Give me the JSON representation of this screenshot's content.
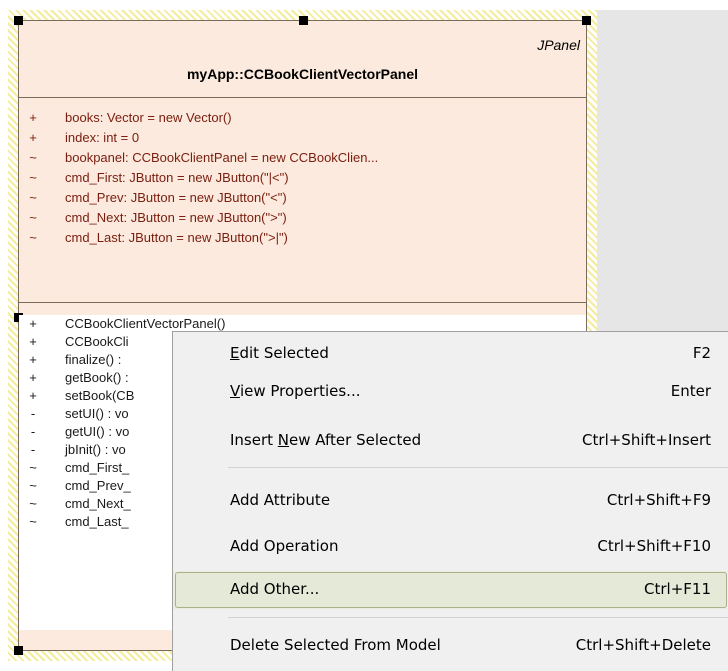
{
  "uml_class": {
    "stereotype": "JPanel",
    "name": "myApp::CCBookClientVectorPanel",
    "attributes": [
      {
        "vis": "+",
        "text": "books:  Vector = new Vector()"
      },
      {
        "vis": "+",
        "text": "index:  int = 0"
      },
      {
        "vis": "~",
        "text": "bookpanel:  CCBookClientPanel = new CCBookClien..."
      },
      {
        "vis": "~",
        "text": "cmd_First:  JButton = new JButton(\"|<\")"
      },
      {
        "vis": "~",
        "text": "cmd_Prev:  JButton = new JButton(\"<\")"
      },
      {
        "vis": "~",
        "text": "cmd_Next:  JButton = new JButton(\">\")"
      },
      {
        "vis": "~",
        "text": "cmd_Last:  JButton = new JButton(\">|\")"
      }
    ],
    "operations": [
      {
        "vis": "+",
        "text": "CCBookClientVectorPanel()"
      },
      {
        "vis": "+",
        "text": "CCBookCli"
      },
      {
        "vis": "+",
        "text": "finalize() :"
      },
      {
        "vis": "+",
        "text": "getBook() :"
      },
      {
        "vis": "+",
        "text": "setBook(CB"
      },
      {
        "vis": "-",
        "text": "setUI() : vo"
      },
      {
        "vis": "-",
        "text": "getUI() : vo"
      },
      {
        "vis": "-",
        "text": "jbInit() : vo"
      },
      {
        "vis": "~",
        "text": "cmd_First_"
      },
      {
        "vis": "~",
        "text": "cmd_Prev_"
      },
      {
        "vis": "~",
        "text": "cmd_Next_"
      },
      {
        "vis": "~",
        "text": "cmd_Last_"
      }
    ]
  },
  "context_menu": {
    "items": [
      {
        "pre": "",
        "u": "E",
        "post": "dit Selected",
        "shortcut": "F2"
      },
      {
        "pre": "",
        "u": "V",
        "post": "iew Properties...",
        "shortcut": "Enter"
      },
      {
        "pre": "Insert ",
        "u": "N",
        "post": "ew After Selected",
        "shortcut": "Ctrl+Shift+Insert"
      },
      {
        "pre": "Add Attribute",
        "u": "",
        "post": "",
        "shortcut": "Ctrl+Shift+F9"
      },
      {
        "pre": "Add Operation",
        "u": "",
        "post": "",
        "shortcut": "Ctrl+Shift+F10"
      },
      {
        "pre": "Add Other...",
        "u": "",
        "post": "",
        "shortcut": "Ctrl+F11"
      },
      {
        "pre": "Delete Selected From Model",
        "u": "",
        "post": "",
        "shortcut": "Ctrl+Shift+Delete"
      }
    ],
    "highlighted_index": 5
  }
}
